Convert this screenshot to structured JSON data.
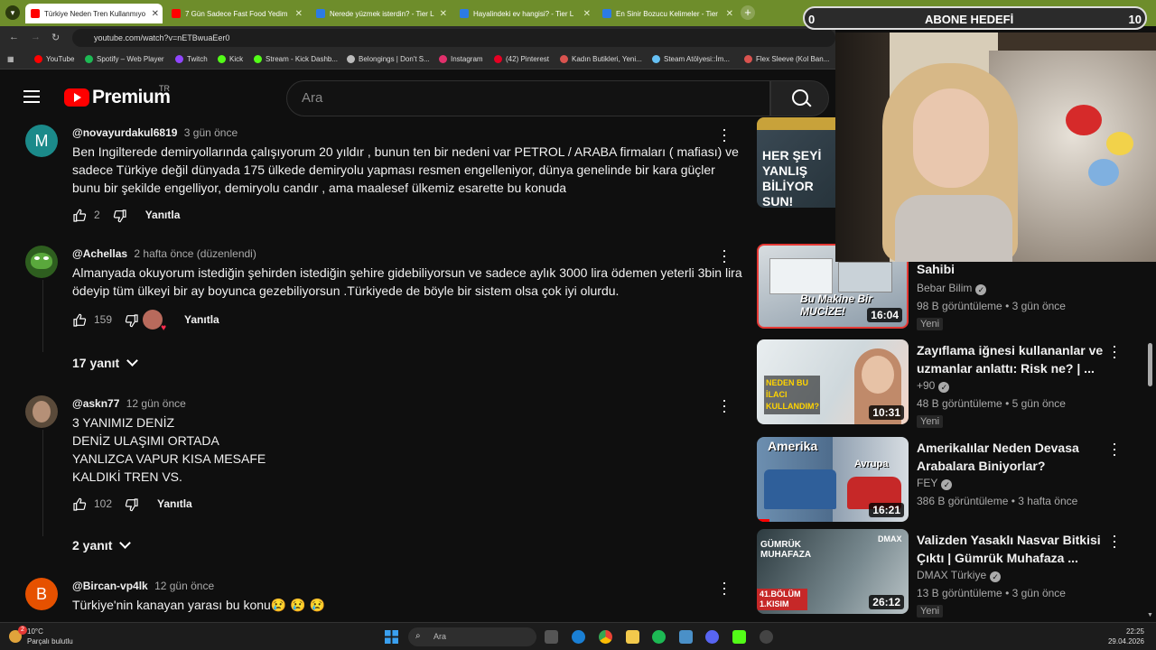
{
  "browser": {
    "tabs": [
      {
        "label": "Türkiye Neden Tren Kullanmıyo",
        "active": true,
        "fav": "#ff0000"
      },
      {
        "label": "7 Gün Sadece Fast Food Yedim",
        "active": false,
        "fav": "#ff0000"
      },
      {
        "label": "Nerede yüzmek isterdin? - Tier L",
        "active": false,
        "fav": "#2c7be5"
      },
      {
        "label": "Hayalindeki ev hangisi? - Tier L",
        "active": false,
        "fav": "#2c7be5"
      },
      {
        "label": "En Sinir Bozucu Kelimeler - Tier",
        "active": false,
        "fav": "#2c7be5"
      }
    ],
    "url": "youtube.com/watch?v=nETBwuaEer0",
    "bookmarks": [
      {
        "label": "YouTube",
        "color": "#ff0000"
      },
      {
        "label": "Spotify – Web Player",
        "color": "#1db954"
      },
      {
        "label": "Twitch",
        "color": "#9146ff"
      },
      {
        "label": "Kick",
        "color": "#53fc18"
      },
      {
        "label": "Stream - Kick Dashb...",
        "color": "#53fc18"
      },
      {
        "label": "Belongings | Don't S...",
        "color": "#bbbbbb"
      },
      {
        "label": "Instagram",
        "color": "#e1306c"
      },
      {
        "label": "(42) Pinterest",
        "color": "#e60023"
      },
      {
        "label": "Kadın Butikleri, Yeni...",
        "color": "#d9534f"
      },
      {
        "label": "Steam Atölyesi::İm...",
        "color": "#66c0f4"
      },
      {
        "label": "Flex Sleeve (Kol Ban...",
        "color": "#d9534f"
      }
    ]
  },
  "youtube": {
    "logo_text": "Premium",
    "country": "TR",
    "search_placeholder": "Ara"
  },
  "comments": [
    {
      "handle": "@novayurdakul6819",
      "time": "3 gün önce",
      "avatar_letter": "M",
      "avatar_color": "#1b8a8a",
      "text": "Ben Ingilterede demiryollarında çalışıyorum 20 yıldır , bunun ten bir nedeni var PETROL / ARABA firmaları ( mafiası) ve sadece Türkiye değil dünyada 175 ülkede demiryolu yapması resmen engelleniyor, dünya genelinde bir kara güçler bunu bir şekilde engelliyor, demiryolu candır , ama maalesef ülkemiz esarette bu konuda",
      "likes": "2",
      "reply": "Yanıtla"
    },
    {
      "handle": "@Achellas",
      "time": "2 hafta önce (düzenlendi)",
      "avatar_letter": "",
      "avatar_color": "#3d7a2a",
      "text": "Almanyada okuyorum istediğin şehirden istediğin şehire gidebiliyorsun ve sadece aylık 3000 lira ödemen yeterli 3bin lira ödeyip tüm ülkeyi bir ay boyunca gezebiliyorsun .Türkiyede de böyle bir sistem olsa çok iyi olurdu.",
      "likes": "159",
      "reply": "Yanıtla",
      "replies": "17 yanıt"
    },
    {
      "handle": "@askn77",
      "time": "12 gün önce",
      "avatar_letter": "",
      "avatar_color": "#5a4a3a",
      "text": "3 YANIMIZ DENİZ\n DENİZ ULAŞIMI  ORTADA\nYANLIZCA VAPUR KISA MESAFE\nKALDIKİ TREN VS.",
      "likes": "102",
      "reply": "Yanıtla",
      "replies": "2 yanıt"
    },
    {
      "handle": "@Bircan-vp4lk",
      "time": "12 gün önce",
      "avatar_letter": "B",
      "avatar_color": "#e65100",
      "text": "Türkiye'nin kanayan yarası bu konu😢 😢 😢"
    }
  ],
  "sidebar": [
    {
      "thumb_text": "HER ŞEYİ YANLIŞ BİLİYOR SUN!",
      "partial": true
    },
    {
      "title": "Sahibi",
      "channel": "Bebar Bilim",
      "stats": "98 B görüntüleme • 3 gün önce",
      "badge": "Yeni",
      "duration": "16:04",
      "thumb_text": "Bu Makine Bir MUCİZE!"
    },
    {
      "title": "Zayıflama iğnesi kullananlar ve uzmanlar anlattı: Risk ne? | ...",
      "channel": "+90",
      "stats": "48 B görüntüleme • 5 gün önce",
      "badge": "Yeni",
      "duration": "10:31",
      "thumb_text": "NEDEN BU İLACI KULLANDIM?"
    },
    {
      "title": "Amerikalılar Neden Devasa Arabalara Biniyorlar?",
      "channel": "FEY",
      "stats": "386 B görüntüleme • 3 hafta önce",
      "duration": "16:21",
      "thumb_text": "Amerika",
      "thumb_text2": "Avrupa"
    },
    {
      "title": "Valizden Yasaklı Nasvar Bitkisi Çıktı | Gümrük Muhafaza ...",
      "channel": "DMAX Türkiye",
      "stats": "13 B görüntüleme • 3 gün önce",
      "badge": "Yeni",
      "duration": "26:12",
      "thumb_text": "GÜMRÜK MUHAFAZA",
      "thumb_text2": "41.BÖLÜM 1.KISIM",
      "thumb_text3": "DMAX"
    }
  ],
  "overlay": {
    "goal_label": "ABONE HEDEFİ",
    "goal_min": "0",
    "goal_max": "10"
  },
  "taskbar": {
    "weather_temp": "10°C",
    "weather_desc": "Parçalı bulutlu",
    "search": "Ara",
    "time": "22:25",
    "date": "29.04.2026",
    "notif_count": "2"
  }
}
